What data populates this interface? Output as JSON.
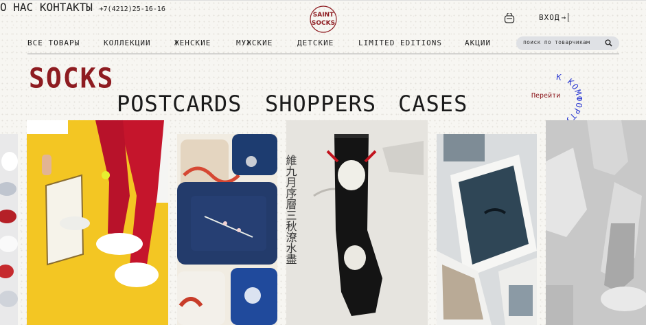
{
  "header": {
    "nav_left": [
      "О НАС",
      "КОНТАКТЫ"
    ],
    "logo_alt": "SAINT SOCKS",
    "phone": "+7(4212)25-16-16",
    "login_label": "ВХОД"
  },
  "categories": [
    "ВСЕ ТОВАРЫ",
    "КОЛЛЕКЦИИ",
    "ЖЕНСКИЕ",
    "МУЖСКИЕ",
    "ДЕТСКИЕ",
    "LIMITED EDITIONS",
    "АКЦИИ"
  ],
  "search": {
    "placeholder": "поиск по товарчикам"
  },
  "hero": {
    "title": "SOCKS",
    "subtitles": [
      "POSTCARDS",
      "SHOPPERS",
      "CASES"
    ],
    "badge_action": "Перейти",
    "badge_ring": "К КОМФОРТУ"
  },
  "colors": {
    "brand": "#8e1c21",
    "ring": "#2d3bd1",
    "bg": "#f7f6f2"
  },
  "cards": [
    {
      "name": "socks-rack-card"
    },
    {
      "name": "red-tights-card"
    },
    {
      "name": "phone-cases-card"
    },
    {
      "name": "oni-sock-card"
    },
    {
      "name": "postcards-card"
    },
    {
      "name": "statue-sock-card"
    }
  ]
}
